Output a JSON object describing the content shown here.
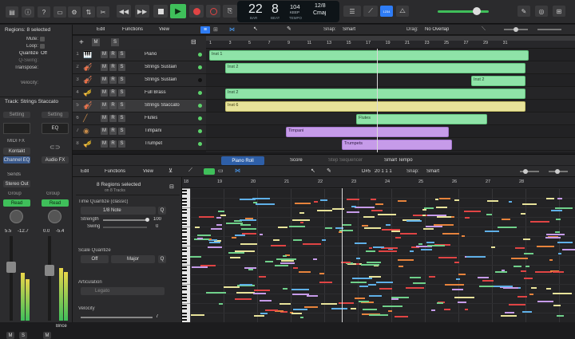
{
  "control_bar": {
    "lcd_bar": "22",
    "lcd_beat": "8",
    "lcd_bar_label": "BAR",
    "lcd_beat_label": "BEAT",
    "lcd_tempo": "104",
    "lcd_tempo_sub": "KEEP",
    "lcd_tempo_label": "TEMPO",
    "lcd_sig": "12/8",
    "lcd_key": "Cmaj",
    "counter_label": "1234",
    "colors": {
      "play": "#3fbf5a",
      "record": "#e04444",
      "accent": "#2e7cf6",
      "lcd": "#0e1418"
    }
  },
  "inspector": {
    "header": "Regions: 8 selected",
    "rows": [
      {
        "label": "Mute:",
        "value": ""
      },
      {
        "label": "Loop:",
        "value": ""
      },
      {
        "label": "Quantize",
        "value": "Off"
      },
      {
        "label": "Q-Swing:",
        "value": ""
      },
      {
        "label": "Transpose:",
        "value": ""
      },
      {
        "label": "Velocity:",
        "value": ""
      }
    ],
    "track_header": "Track: Strings Staccato",
    "strip1": {
      "setting": "Setting",
      "midi_fx": "MIDI FX",
      "plugin1": "Kontakt",
      "plugin2": "Channel EQ",
      "send": "Sends",
      "output": "Stereo Out",
      "group": "Group",
      "read": "Read",
      "vol_a": "5.5",
      "vol_b": "-12.7",
      "m": "M",
      "s": "S"
    },
    "strip2": {
      "setting": "Setting",
      "eq": "EQ",
      "plugin1": "Audio FX",
      "group": "Group",
      "read": "Read",
      "vol_a": "0.0",
      "vol_b": "-5.4",
      "m": "M",
      "name": "Bnce"
    }
  },
  "tracks_toolbar": {
    "edit": "Edit",
    "functions": "Functions",
    "view": "View",
    "snap_label": "Snap:",
    "snap_value": "Smart",
    "drag_label": "Drag:",
    "drag_value": "No Overlap"
  },
  "ruler": [
    "1",
    "3",
    "5",
    "7",
    "9",
    "11",
    "13",
    "15",
    "17",
    "19",
    "21",
    "23",
    "25",
    "27",
    "29",
    "31"
  ],
  "tracks": [
    {
      "num": "1",
      "name": "Piano",
      "icon": "piano-icon"
    },
    {
      "num": "2",
      "name": "Strings Sustain",
      "icon": "strings-icon"
    },
    {
      "num": "3",
      "name": "Strings Sustain",
      "icon": "strings-icon"
    },
    {
      "num": "4",
      "name": "Full Brass",
      "icon": "brass-icon"
    },
    {
      "num": "5",
      "name": "Strings Staccato",
      "icon": "strings-icon"
    },
    {
      "num": "6",
      "name": "Flutes",
      "icon": "flute-icon"
    },
    {
      "num": "7",
      "name": "Timpani",
      "icon": "timpani-icon"
    },
    {
      "num": "8",
      "name": "Trumpet",
      "icon": "trumpet-icon"
    }
  ],
  "regions": [
    {
      "label": "Inst 1"
    },
    {
      "label": "Inst 2"
    },
    {
      "label": "Inst 2"
    },
    {
      "label": "Inst 2"
    },
    {
      "label": "Inst 6"
    },
    {
      "label": "Flutes"
    },
    {
      "label": "Timpani"
    },
    {
      "label": "Trumpets"
    }
  ],
  "editor": {
    "tabs": [
      "Piano Roll",
      "Score",
      "Step Sequencer",
      "Smart Tempo"
    ],
    "edit": "Edit",
    "functions": "Functions",
    "view": "View",
    "position_note": "D#5",
    "position_time": "20 1 1 1",
    "snap_label": "Snap:",
    "snap_value": "Smart",
    "ruler": [
      "18",
      "19",
      "20",
      "21",
      "22",
      "23",
      "24",
      "25",
      "26",
      "27",
      "28"
    ],
    "c_labels": [
      "C5",
      "C4",
      "C3"
    ],
    "selection_title": "8 Regions selected",
    "selection_sub": "on 8 Tracks",
    "time_quantize_label": "Time Quantize (classic)",
    "time_quantize_value": "1/8 Note",
    "strength_label": "Strength",
    "strength_value": "100",
    "swing_label": "Swing",
    "swing_value": "0",
    "scale_quantize_label": "Scale Quantize",
    "scale_off": "Off",
    "scale_major": "Major",
    "q_button": "Q",
    "articulation_label": "Articulation",
    "articulation_value": "Legato",
    "velocity_label": "Velocity",
    "velocity_value": "7"
  }
}
